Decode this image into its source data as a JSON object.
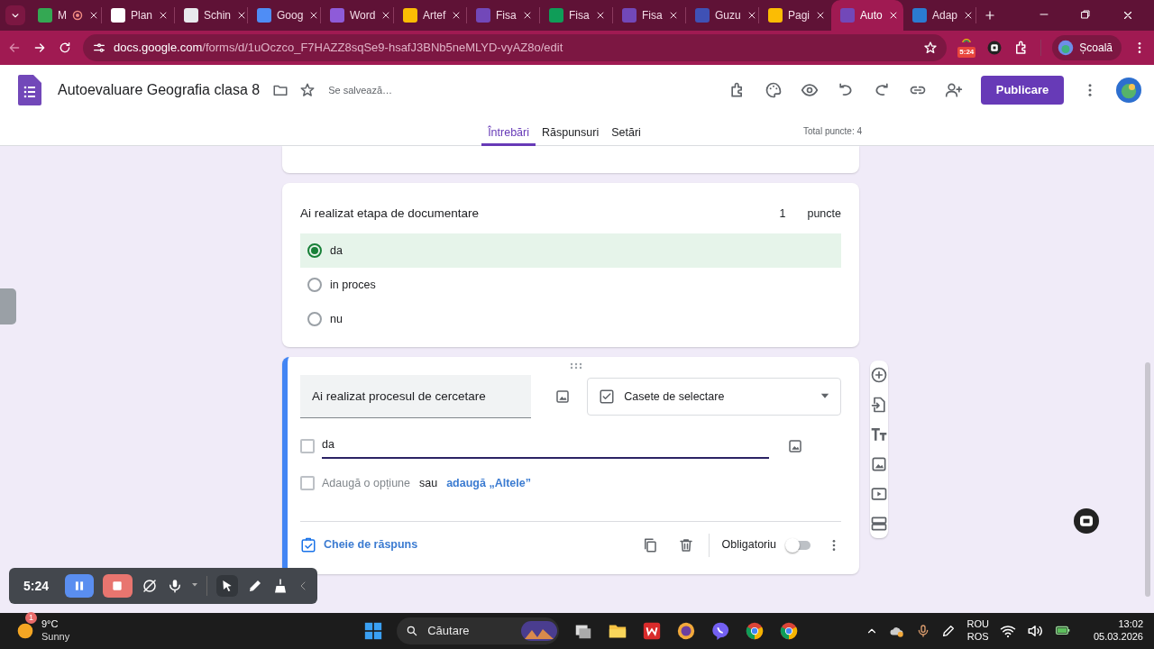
{
  "browser": {
    "tabs": [
      {
        "label": "M",
        "color": "#34a853",
        "recording": true,
        "selected": false
      },
      {
        "label": "Plan",
        "color": "#ffffff",
        "recording": false,
        "selected": false
      },
      {
        "label": "Schin",
        "color": "#e8eaed",
        "recording": false,
        "selected": false
      },
      {
        "label": "Goog",
        "color": "#4f8df5",
        "recording": false,
        "selected": false
      },
      {
        "label": "Word",
        "color": "#8e5bd9",
        "recording": false,
        "selected": false
      },
      {
        "label": "Artef",
        "color": "#fbbc04",
        "recording": false,
        "selected": false
      },
      {
        "label": "Fisa",
        "color": "#7248b9",
        "recording": false,
        "selected": false
      },
      {
        "label": "Fisa",
        "color": "#0f9d58",
        "recording": false,
        "selected": false
      },
      {
        "label": "Fisa",
        "color": "#7248b9",
        "recording": false,
        "selected": false
      },
      {
        "label": "Guzu",
        "color": "#3f51b5",
        "recording": false,
        "selected": false
      },
      {
        "label": "Pagi",
        "color": "#fbbc04",
        "recording": false,
        "selected": false
      },
      {
        "label": "Auto",
        "color": "#7248b9",
        "recording": false,
        "selected": true
      },
      {
        "label": "Adap",
        "color": "#2b7bd1",
        "recording": false,
        "selected": false
      }
    ],
    "url_host": "docs.google.com",
    "url_path": "/forms/d/1uOczco_F7HAZZ8sqSe9-hsafJ3BNb5neMLYD-vyAZ8o/edit",
    "extension_badge": "5:24",
    "profile": "Școală"
  },
  "form_header": {
    "title": "Autoevaluare Geografia clasa 8",
    "save_status": "Se salvează…",
    "publish": "Publicare",
    "tabs": [
      {
        "label": "Întrebări",
        "selected": true
      },
      {
        "label": "Răspunsuri",
        "selected": false
      },
      {
        "label": "Setări",
        "selected": false
      }
    ],
    "total_points": "Total puncte: 4"
  },
  "questions": [
    {
      "kind": "view",
      "title": "Ai realizat etapa de documentare",
      "points": "1",
      "points_label": "puncte",
      "options": [
        {
          "label": "da",
          "selected": true
        },
        {
          "label": "in proces",
          "selected": false
        },
        {
          "label": "nu",
          "selected": false
        }
      ]
    },
    {
      "kind": "edit",
      "title": "Ai realizat procesul de cercetare",
      "type": "Casete de selectare",
      "options": [
        {
          "value": "da",
          "checked": false
        }
      ],
      "add_option_checked": false,
      "add_option": "Adaugă o opțiune",
      "or": "sau",
      "add_other": "adaugă „Altele”",
      "answer_key": "Cheie de răspuns",
      "required_label": "Obligatoriu",
      "required": false
    }
  ],
  "recorder": {
    "time": "5:24"
  },
  "taskbar": {
    "weather_temp": "9°C",
    "weather_text": "Sunny",
    "weather_badge": "1",
    "search_placeholder": "Căutare",
    "language": "ROU",
    "layout": "ROS",
    "time": "13:02",
    "date": "05.03.2026"
  }
}
